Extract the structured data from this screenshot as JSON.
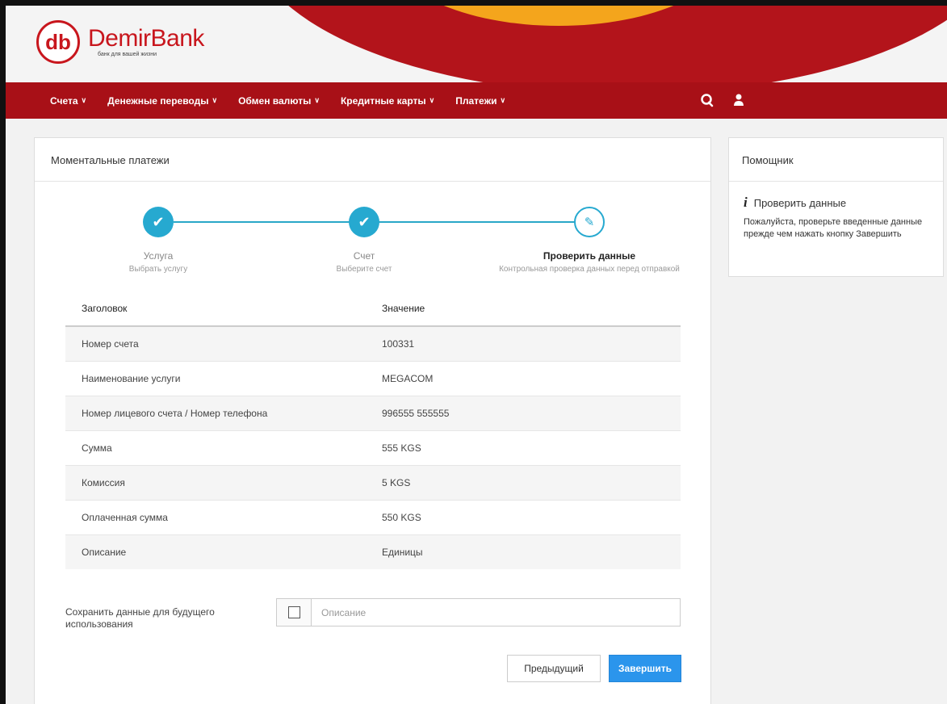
{
  "brand": {
    "logo_mark": "db",
    "name": "DemirBank",
    "tagline": "банк для вашей жизни",
    "primary_color": "#a81017",
    "accent_orange": "#f4a51c"
  },
  "nav": {
    "items": [
      {
        "label": "Счета",
        "icon": "chevron-down-icon"
      },
      {
        "label": "Денежные переводы",
        "icon": "chevron-down-icon"
      },
      {
        "label": "Обмен валюты",
        "icon": "chevron-down-icon"
      },
      {
        "label": "Кредитные карты",
        "icon": "chevron-down-icon"
      },
      {
        "label": "Платежи",
        "icon": "chevron-down-icon"
      }
    ],
    "right_icons": [
      "chat-icon",
      "user-icon"
    ]
  },
  "main": {
    "title": "Моментальные платежи",
    "steps": [
      {
        "title": "Услуга",
        "subtitle": "Выбрать услугу",
        "state": "done"
      },
      {
        "title": "Счет",
        "subtitle": "Выберите счет",
        "state": "done"
      },
      {
        "title": "Проверить данные",
        "subtitle": "Контрольная проверка данных перед отправкой",
        "state": "current"
      }
    ],
    "table": {
      "headers": [
        "Заголовок",
        "Значение"
      ],
      "rows": [
        [
          "Номер счета",
          "100331"
        ],
        [
          "Наименование услуги",
          "MEGACOM"
        ],
        [
          "Номер лицевого счета / Номер телефона",
          "996555 555555"
        ],
        [
          "Сумма",
          "555 KGS"
        ],
        [
          "Комиссия",
          "5 KGS"
        ],
        [
          "Оплаченная сумма",
          "550 KGS"
        ],
        [
          "Описание",
          "Единицы"
        ]
      ]
    },
    "save": {
      "label": "Сохранить данные для будущего использования",
      "checked": false,
      "placeholder": "Описание",
      "value": ""
    },
    "buttons": {
      "prev": "Предыдущий",
      "finish": "Завершить"
    }
  },
  "helper": {
    "title": "Помощник",
    "info_title": "Проверить данные",
    "info_text": "Пожалуйста, проверьте введенные данные прежде чем нажать кнопку Завершить"
  }
}
